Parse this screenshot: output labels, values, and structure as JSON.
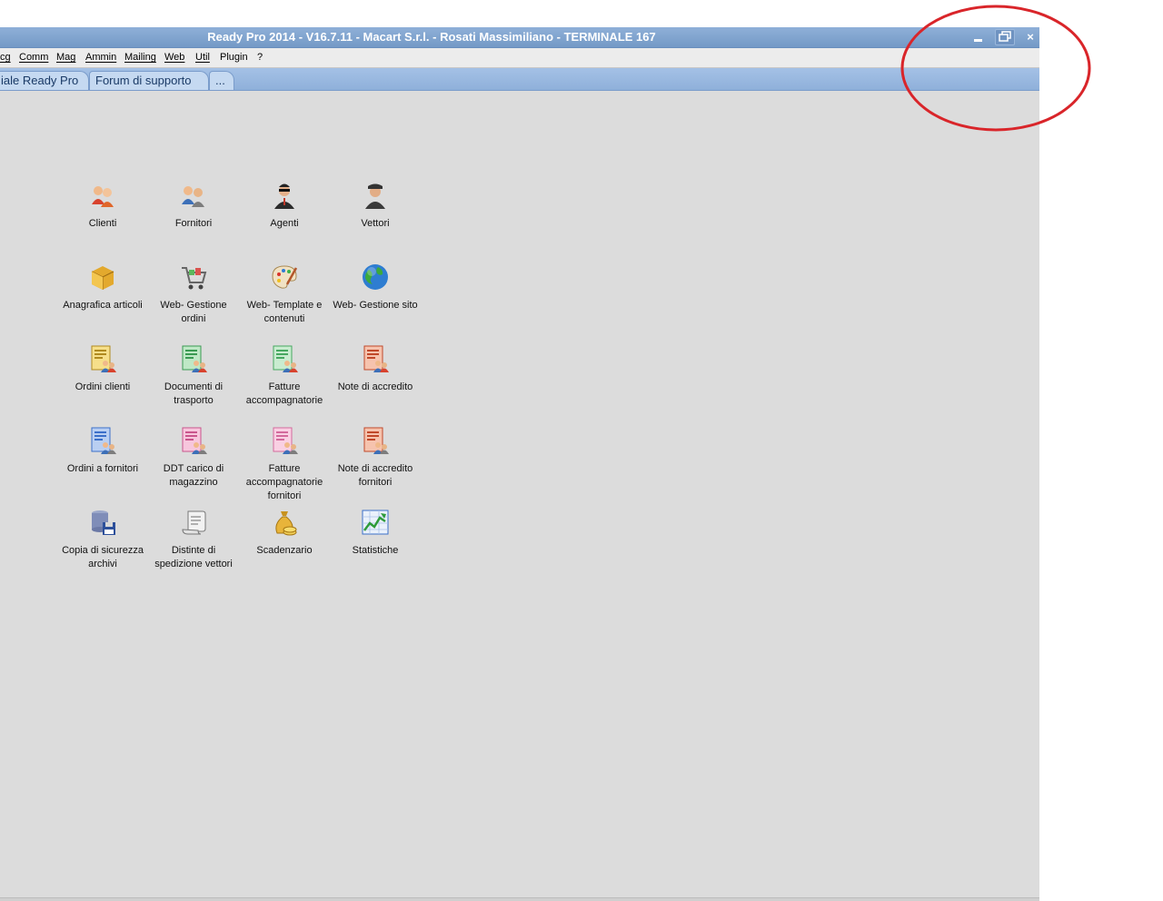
{
  "window": {
    "title": "Ready Pro 2014 - V16.7.11 - Macart S.r.l. - Rosati Massimiliano - TERMINALE 167",
    "minimize": "▁",
    "restore": "⧉",
    "close": "×"
  },
  "menu": [
    {
      "label": "cg"
    },
    {
      "label": "Comm"
    },
    {
      "label": "Mag"
    },
    {
      "label": "Ammin"
    },
    {
      "label": "Mailing"
    },
    {
      "label": "Web"
    },
    {
      "label": "Util"
    },
    {
      "label": "Plugin"
    },
    {
      "label": "?"
    }
  ],
  "tabs": [
    {
      "label": "iale Ready Pro"
    },
    {
      "label": "Forum di supporto"
    },
    {
      "label": "..."
    }
  ],
  "desktop_icons": [
    {
      "label": "Clienti",
      "icon": "clienti-icon"
    },
    {
      "label": "Fornitori",
      "icon": "fornitori-icon"
    },
    {
      "label": "Agenti",
      "icon": "agenti-icon"
    },
    {
      "label": "Vettori",
      "icon": "vettori-icon"
    },
    {
      "label": "Anagrafica articoli",
      "icon": "articles-box-icon"
    },
    {
      "label": "Web- Gestione ordini",
      "icon": "cart-icon"
    },
    {
      "label": "Web- Template e contenuti",
      "icon": "palette-icon"
    },
    {
      "label": "Web- Gestione sito",
      "icon": "globe-icon"
    },
    {
      "label": "Ordini clienti",
      "icon": "document-people-icon"
    },
    {
      "label": "Documenti di trasporto",
      "icon": "document-people-icon"
    },
    {
      "label": "Fatture accompagnatorie",
      "icon": "document-people-icon"
    },
    {
      "label": "Note di accredito",
      "icon": "document-people-icon"
    },
    {
      "label": "Ordini a fornitori",
      "icon": "document-people-icon"
    },
    {
      "label": "DDT carico di magazzino",
      "icon": "document-people-icon"
    },
    {
      "label": "Fatture accompagnatorie fornitori",
      "icon": "document-people-icon"
    },
    {
      "label": "Note di accredito fornitori",
      "icon": "document-people-icon"
    },
    {
      "label": "Copia di sicurezza archivi",
      "icon": "backup-disk-icon"
    },
    {
      "label": "Distinte di spedizione vettori",
      "icon": "scroll-icon"
    },
    {
      "label": "Scadenzario",
      "icon": "money-bag-icon"
    },
    {
      "label": "Statistiche",
      "icon": "statistics-chart-icon"
    }
  ],
  "colors": {
    "titlebar": "#7ea3d0",
    "desktop": "#dcdcdc",
    "annotation": "#d9252a",
    "doc_yellow": "#e8c44a",
    "doc_green": "#4bb56a",
    "doc_red": "#d2522f",
    "doc_blue": "#3b6fc9",
    "doc_pink": "#e47fb0"
  }
}
